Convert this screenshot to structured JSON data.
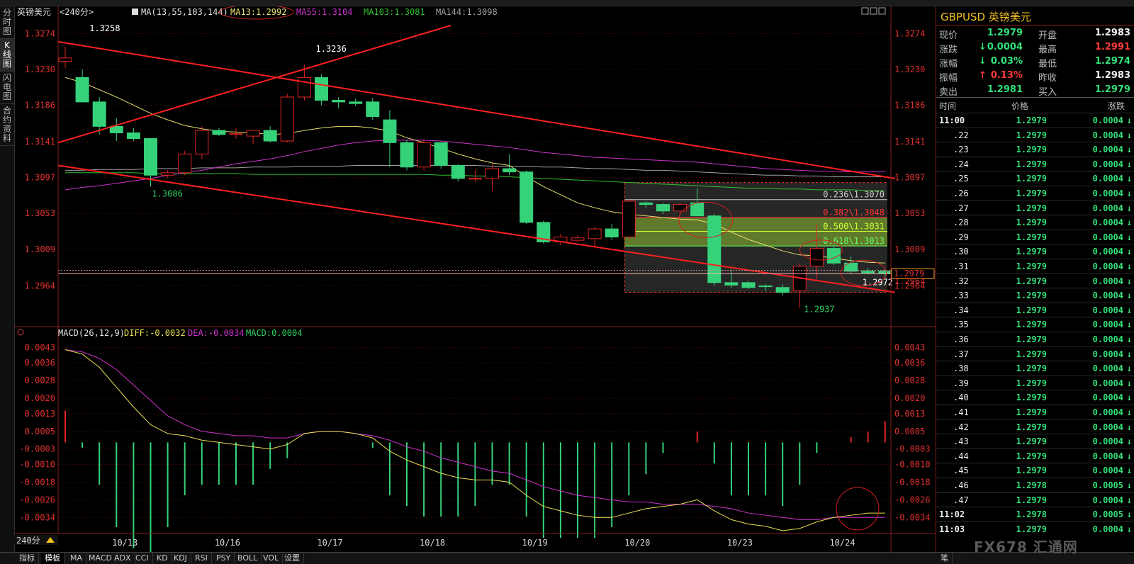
{
  "chart_header": {
    "symbol_label": "英镑美元",
    "period": "<240分>",
    "ma_params": "MA(13,55,103,144)",
    "ma13": "MA13:1.2992",
    "ma55": "MA55:1.3104",
    "ma103": "MA103:1.3081",
    "ma144": "MA144:1.3098"
  },
  "macd_header": {
    "params": "MACD(26,12,9)",
    "diff": "DIFF:-0.0032",
    "dea": "DEA:-0.0034",
    "macd": "MACD:0.0004"
  },
  "left_tabs": [
    {
      "label": "分时图",
      "active": false
    },
    {
      "label": "K线图",
      "active": true
    },
    {
      "label": "闪电图",
      "active": false
    },
    {
      "label": "合约资料",
      "active": false
    }
  ],
  "period_selector": "240分",
  "bottom_tabs": [
    "指标",
    "模板",
    "MA",
    "MACD",
    "ADX",
    "CCI",
    "KD",
    "KDJ",
    "RSI",
    "PSY",
    "BOLL",
    "VOL",
    "设置"
  ],
  "right_bottom_tab": "笔",
  "price_axis_labels": [
    "1.3274",
    "1.3230",
    "1.3186",
    "1.3141",
    "1.3097",
    "1.3053",
    "1.3009",
    "1.2964"
  ],
  "macd_axis_labels": [
    "0.0043",
    "0.0036",
    "0.0028",
    "0.0020",
    "0.0013",
    "0.0005",
    "-0.0003",
    "-0.0010",
    "-0.0018",
    "-0.0026",
    "-0.0034"
  ],
  "date_labels": [
    "10/13",
    "10/16",
    "10/17",
    "10/18",
    "10/19",
    "10/20",
    "10/23",
    "10/24"
  ],
  "annotations": {
    "high1": "1.3258",
    "high2": "1.3236",
    "low1": "1.3086",
    "low2": "1.2937",
    "current_price_tag": "1.2979",
    "right_axis_low_overlap": "1.2964",
    "ma13_marker": "1.2972",
    "fib": [
      "0.236\\1.3070",
      "0.382\\1.3048",
      "0.500\\1.3031",
      "0.618\\1.3013"
    ]
  },
  "colors": {
    "up_candle": "#e02424",
    "down_candle": "#36d27a",
    "ma13": "#e8e070",
    "ma55": "#cc33cc",
    "ma103": "#30c030",
    "ma144": "#a0a0a0",
    "trend_line": "#ff2020",
    "diff_line": "#e8e050",
    "dea_line": "#d030d0"
  },
  "quote": {
    "title": "GBPUSD 英镑美元",
    "rows": [
      {
        "l1": "现价",
        "v1": "1.2979",
        "l2": "开盘",
        "v2": "1.2983"
      },
      {
        "l1": "涨跌",
        "v1": "0.0004",
        "l2": "最高",
        "v2": "1.2991"
      },
      {
        "l1": "涨幅",
        "v1": "0.03%",
        "l2": "最低",
        "v2": "1.2974"
      },
      {
        "l1": "振幅",
        "v1": "0.13%",
        "l2": "昨收",
        "v2": "1.2983"
      },
      {
        "l1": "卖出",
        "v1": "1.2981",
        "l2": "买入",
        "v2": "1.2979"
      }
    ]
  },
  "ticks_header": {
    "time": "时间",
    "price": "价格",
    "change": "涨跌"
  },
  "ticks": [
    {
      "t": "11:00",
      "p": "1.2979",
      "c": "0.0004"
    },
    {
      "t": ".22",
      "p": "1.2979",
      "c": "0.0004"
    },
    {
      "t": ".23",
      "p": "1.2979",
      "c": "0.0004"
    },
    {
      "t": ".24",
      "p": "1.2979",
      "c": "0.0004"
    },
    {
      "t": ".25",
      "p": "1.2979",
      "c": "0.0004"
    },
    {
      "t": ".26",
      "p": "1.2979",
      "c": "0.0004"
    },
    {
      "t": ".27",
      "p": "1.2979",
      "c": "0.0004"
    },
    {
      "t": ".28",
      "p": "1.2979",
      "c": "0.0004"
    },
    {
      "t": ".29",
      "p": "1.2979",
      "c": "0.0004"
    },
    {
      "t": ".30",
      "p": "1.2979",
      "c": "0.0004"
    },
    {
      "t": ".31",
      "p": "1.2979",
      "c": "0.0004"
    },
    {
      "t": ".32",
      "p": "1.2979",
      "c": "0.0004"
    },
    {
      "t": ".33",
      "p": "1.2979",
      "c": "0.0004"
    },
    {
      "t": ".34",
      "p": "1.2979",
      "c": "0.0004"
    },
    {
      "t": ".35",
      "p": "1.2979",
      "c": "0.0004"
    },
    {
      "t": ".36",
      "p": "1.2979",
      "c": "0.0004"
    },
    {
      "t": ".37",
      "p": "1.2979",
      "c": "0.0004"
    },
    {
      "t": ".38",
      "p": "1.2979",
      "c": "0.0004"
    },
    {
      "t": ".39",
      "p": "1.2979",
      "c": "0.0004"
    },
    {
      "t": ".40",
      "p": "1.2979",
      "c": "0.0004"
    },
    {
      "t": ".41",
      "p": "1.2979",
      "c": "0.0004"
    },
    {
      "t": ".42",
      "p": "1.2979",
      "c": "0.0004"
    },
    {
      "t": ".43",
      "p": "1.2979",
      "c": "0.0004"
    },
    {
      "t": ".44",
      "p": "1.2979",
      "c": "0.0004"
    },
    {
      "t": ".45",
      "p": "1.2979",
      "c": "0.0004"
    },
    {
      "t": ".46",
      "p": "1.2978",
      "c": "0.0005"
    },
    {
      "t": ".47",
      "p": "1.2979",
      "c": "0.0004"
    },
    {
      "t": "11:02",
      "p": "1.2978",
      "c": "0.0005"
    },
    {
      "t": "11:03",
      "p": "1.2979",
      "c": "0.0004"
    }
  ],
  "watermark": "FX678 汇通网",
  "chart_data": {
    "type": "candlestick",
    "title": "",
    "y_range": [
      1.292,
      1.329
    ],
    "macd_range": [
      -0.004,
      0.0046
    ],
    "candles": [
      {
        "o": 1.324,
        "h": 1.3258,
        "l": 1.3232,
        "c": 1.3244
      },
      {
        "o": 1.322,
        "h": 1.323,
        "l": 1.319,
        "c": 1.319
      },
      {
        "o": 1.319,
        "h": 1.3196,
        "l": 1.315,
        "c": 1.316
      },
      {
        "o": 1.316,
        "h": 1.317,
        "l": 1.3142,
        "c": 1.3152
      },
      {
        "o": 1.3152,
        "h": 1.3158,
        "l": 1.3142,
        "c": 1.3145
      },
      {
        "o": 1.3145,
        "h": 1.3145,
        "l": 1.3086,
        "c": 1.31
      },
      {
        "o": 1.31,
        "h": 1.3106,
        "l": 1.3097,
        "c": 1.3103
      },
      {
        "o": 1.3103,
        "h": 1.313,
        "l": 1.31,
        "c": 1.3126
      },
      {
        "o": 1.3126,
        "h": 1.316,
        "l": 1.312,
        "c": 1.3155
      },
      {
        "o": 1.3155,
        "h": 1.3158,
        "l": 1.3148,
        "c": 1.315
      },
      {
        "o": 1.315,
        "h": 1.3158,
        "l": 1.3145,
        "c": 1.3151
      },
      {
        "o": 1.3148,
        "h": 1.3156,
        "l": 1.3138,
        "c": 1.3155
      },
      {
        "o": 1.3155,
        "h": 1.316,
        "l": 1.314,
        "c": 1.3142
      },
      {
        "o": 1.3142,
        "h": 1.32,
        "l": 1.314,
        "c": 1.3196
      },
      {
        "o": 1.3196,
        "h": 1.3236,
        "l": 1.3192,
        "c": 1.322
      },
      {
        "o": 1.322,
        "h": 1.3224,
        "l": 1.3186,
        "c": 1.3192
      },
      {
        "o": 1.3192,
        "h": 1.3196,
        "l": 1.3182,
        "c": 1.319
      },
      {
        "o": 1.319,
        "h": 1.3194,
        "l": 1.3185,
        "c": 1.3188
      },
      {
        "o": 1.319,
        "h": 1.3195,
        "l": 1.3168,
        "c": 1.3172
      },
      {
        "o": 1.3168,
        "h": 1.318,
        "l": 1.311,
        "c": 1.314
      },
      {
        "o": 1.314,
        "h": 1.3144,
        "l": 1.3106,
        "c": 1.311
      },
      {
        "o": 1.311,
        "h": 1.3144,
        "l": 1.3106,
        "c": 1.314
      },
      {
        "o": 1.314,
        "h": 1.314,
        "l": 1.3108,
        "c": 1.3112
      },
      {
        "o": 1.3112,
        "h": 1.3114,
        "l": 1.3092,
        "c": 1.3096
      },
      {
        "o": 1.3096,
        "h": 1.3106,
        "l": 1.3092,
        "c": 1.3096
      },
      {
        "o": 1.3096,
        "h": 1.3114,
        "l": 1.308,
        "c": 1.3108
      },
      {
        "o": 1.3108,
        "h": 1.3126,
        "l": 1.31,
        "c": 1.3104
      },
      {
        "o": 1.3104,
        "h": 1.3106,
        "l": 1.304,
        "c": 1.3042
      },
      {
        "o": 1.3042,
        "h": 1.3044,
        "l": 1.3016,
        "c": 1.3018
      },
      {
        "o": 1.3018,
        "h": 1.3028,
        "l": 1.3014,
        "c": 1.3024
      },
      {
        "o": 1.302,
        "h": 1.3026,
        "l": 1.3018,
        "c": 1.3023
      },
      {
        "o": 1.3022,
        "h": 1.3036,
        "l": 1.3012,
        "c": 1.3034
      },
      {
        "o": 1.3034,
        "h": 1.304,
        "l": 1.302,
        "c": 1.3024
      },
      {
        "o": 1.3024,
        "h": 1.307,
        "l": 1.3022,
        "c": 1.3068
      },
      {
        "o": 1.3066,
        "h": 1.3068,
        "l": 1.306,
        "c": 1.3064
      },
      {
        "o": 1.3064,
        "h": 1.3066,
        "l": 1.3052,
        "c": 1.3056
      },
      {
        "o": 1.3056,
        "h": 1.3066,
        "l": 1.3054,
        "c": 1.3064
      },
      {
        "o": 1.3066,
        "h": 1.3084,
        "l": 1.305,
        "c": 1.305
      },
      {
        "o": 1.305,
        "h": 1.3052,
        "l": 1.2964,
        "c": 1.2968
      },
      {
        "o": 1.2968,
        "h": 1.2984,
        "l": 1.2962,
        "c": 1.2965
      },
      {
        "o": 1.2968,
        "h": 1.297,
        "l": 1.296,
        "c": 1.2962
      },
      {
        "o": 1.2964,
        "h": 1.2966,
        "l": 1.2958,
        "c": 1.2963
      },
      {
        "o": 1.2962,
        "h": 1.2966,
        "l": 1.2952,
        "c": 1.2956
      },
      {
        "o": 1.2958,
        "h": 1.2992,
        "l": 1.2937,
        "c": 1.2988
      },
      {
        "o": 1.2988,
        "h": 1.304,
        "l": 1.2972,
        "c": 1.301
      },
      {
        "o": 1.301,
        "h": 1.3014,
        "l": 1.299,
        "c": 1.2992
      },
      {
        "o": 1.2992,
        "h": 1.3,
        "l": 1.298,
        "c": 1.2982
      },
      {
        "o": 1.2982,
        "h": 1.2986,
        "l": 1.2978,
        "c": 1.298
      },
      {
        "o": 1.2982,
        "h": 1.2984,
        "l": 1.2974,
        "c": 1.2979
      }
    ],
    "ma13": [
      1.322,
      1.3214,
      1.3205,
      1.3196,
      1.3186,
      1.3176,
      1.3168,
      1.3161,
      1.3157,
      1.3154,
      1.3153,
      1.3152,
      1.315,
      1.3151,
      1.3155,
      1.3158,
      1.316,
      1.316,
      1.3158,
      1.3154,
      1.3146,
      1.314,
      1.3133,
      1.3126,
      1.312,
      1.3115,
      1.3112,
      1.3098,
      1.3086,
      1.3076,
      1.3066,
      1.306,
      1.3055,
      1.3052,
      1.305,
      1.3048,
      1.3046,
      1.3045,
      1.304,
      1.303,
      1.3021,
      1.3014,
      1.3007,
      1.3002,
      1.3001,
      1.2998,
      1.2995,
      1.2993,
      1.2992
    ],
    "ma55": [
      1.3082,
      1.3085,
      1.3087,
      1.309,
      1.3093,
      1.3096,
      1.31,
      1.3103,
      1.3106,
      1.311,
      1.3114,
      1.3117,
      1.312,
      1.3124,
      1.3129,
      1.3133,
      1.3137,
      1.314,
      1.3142,
      1.3143,
      1.3143,
      1.3143,
      1.3142,
      1.314,
      1.3138,
      1.3136,
      1.3134,
      1.3131,
      1.3128,
      1.3126,
      1.3124,
      1.3122,
      1.3121,
      1.312,
      1.3119,
      1.3118,
      1.3117,
      1.3116,
      1.3114,
      1.3112,
      1.311,
      1.3108,
      1.3107,
      1.3106,
      1.3105,
      1.3105,
      1.3104,
      1.3104,
      1.3104
    ],
    "ma103": [
      1.3103,
      1.3103,
      1.3103,
      1.3103,
      1.3103,
      1.3102,
      1.3102,
      1.3102,
      1.3102,
      1.3102,
      1.3102,
      1.3101,
      1.3101,
      1.3101,
      1.3101,
      1.3101,
      1.3101,
      1.3101,
      1.3101,
      1.3101,
      1.3101,
      1.3101,
      1.31,
      1.31,
      1.3099,
      1.3099,
      1.3098,
      1.3097,
      1.3096,
      1.3095,
      1.3094,
      1.3093,
      1.3092,
      1.3091,
      1.309,
      1.3089,
      1.3088,
      1.3087,
      1.3086,
      1.3085,
      1.3084,
      1.3084,
      1.3083,
      1.3083,
      1.3082,
      1.3082,
      1.3082,
      1.3081,
      1.3081
    ],
    "ma144": [
      1.3106,
      1.3106,
      1.3107,
      1.3107,
      1.3107,
      1.3108,
      1.3108,
      1.3108,
      1.3109,
      1.3109,
      1.3109,
      1.311,
      1.311,
      1.311,
      1.3111,
      1.3111,
      1.3111,
      1.3112,
      1.3112,
      1.3112,
      1.3112,
      1.3112,
      1.3112,
      1.3112,
      1.3112,
      1.3111,
      1.3111,
      1.3111,
      1.311,
      1.311,
      1.3109,
      1.3108,
      1.3108,
      1.3107,
      1.3106,
      1.3106,
      1.3105,
      1.3104,
      1.3103,
      1.3102,
      1.3101,
      1.31,
      1.31,
      1.3099,
      1.3099,
      1.3098,
      1.3098,
      1.3098,
      1.3098
    ],
    "diff": [
      0.0042,
      0.004,
      0.0034,
      0.0025,
      0.0016,
      0.0008,
      0.0004,
      0.0003,
      0.0001,
      0.0,
      -0.0001,
      -0.0002,
      -0.0003,
      -0.0001,
      0.0004,
      0.0005,
      0.0005,
      0.0004,
      0.0002,
      -0.0004,
      -0.0008,
      -0.0011,
      -0.0014,
      -0.0016,
      -0.0017,
      -0.0017,
      -0.0018,
      -0.0024,
      -0.0029,
      -0.0031,
      -0.0033,
      -0.0034,
      -0.0034,
      -0.0032,
      -0.003,
      -0.0029,
      -0.0028,
      -0.0026,
      -0.0031,
      -0.0035,
      -0.0037,
      -0.0038,
      -0.004,
      -0.0039,
      -0.0036,
      -0.0034,
      -0.0033,
      -0.0032,
      -0.0032
    ],
    "dea": [
      0.0042,
      0.0041,
      0.0038,
      0.0033,
      0.0026,
      0.0019,
      0.0012,
      0.0008,
      0.0005,
      0.0004,
      0.0003,
      0.0003,
      0.0002,
      0.0002,
      0.0004,
      0.0005,
      0.0005,
      0.0004,
      0.0003,
      0.0001,
      -0.0002,
      -0.0004,
      -0.0007,
      -0.0009,
      -0.0011,
      -0.0013,
      -0.0014,
      -0.0017,
      -0.002,
      -0.0022,
      -0.0024,
      -0.0025,
      -0.0026,
      -0.0027,
      -0.0027,
      -0.0028,
      -0.0028,
      -0.0028,
      -0.0029,
      -0.003,
      -0.0032,
      -0.0033,
      -0.0034,
      -0.0035,
      -0.0035,
      -0.0034,
      -0.0034,
      -0.0034,
      -0.0034
    ],
    "macd": [
      0.0006,
      -0.0001,
      -0.0008,
      -0.0016,
      -0.002,
      -0.0022,
      -0.0016,
      -0.001,
      -0.0008,
      -0.0008,
      -0.0008,
      -0.0008,
      -0.0005,
      -0.0003,
      0.0,
      0.0,
      0.0,
      0.0,
      -0.0001,
      -0.001,
      -0.0012,
      -0.0014,
      -0.0014,
      -0.0014,
      -0.0012,
      -0.0008,
      -0.0008,
      -0.0014,
      -0.0018,
      -0.0018,
      -0.0018,
      -0.0018,
      -0.0016,
      -0.001,
      -0.0006,
      -0.0002,
      0.0,
      0.0002,
      -0.0004,
      -0.001,
      -0.001,
      -0.001,
      -0.0012,
      -0.0008,
      -0.0002,
      0.0,
      0.0001,
      0.0002,
      0.0004
    ],
    "trendlines": [
      {
        "name": "upper_channel",
        "from": [
          0,
          1.3264
        ],
        "to": [
          48,
          1.3096
        ]
      },
      {
        "name": "lower_channel",
        "from": [
          0,
          1.3112
        ],
        "to": [
          48,
          1.2956
        ]
      },
      {
        "name": "rising",
        "from": [
          0,
          1.314
        ],
        "to": [
          22,
          1.3284
        ]
      }
    ],
    "fib_levels": [
      1.307,
      1.3048,
      1.3031,
      1.3013
    ],
    "fib_high": 1.3091,
    "fib_low": 1.2956,
    "current_price": 1.2979,
    "xlabels": [
      {
        "label": "10/13",
        "idx": 3
      },
      {
        "label": "10/16",
        "idx": 9
      },
      {
        "label": "10/17",
        "idx": 15
      },
      {
        "label": "10/18",
        "idx": 21
      },
      {
        "label": "10/19",
        "idx": 27
      },
      {
        "label": "10/20",
        "idx": 33
      },
      {
        "label": "10/23",
        "idx": 39
      },
      {
        "label": "10/24",
        "idx": 45
      }
    ]
  }
}
